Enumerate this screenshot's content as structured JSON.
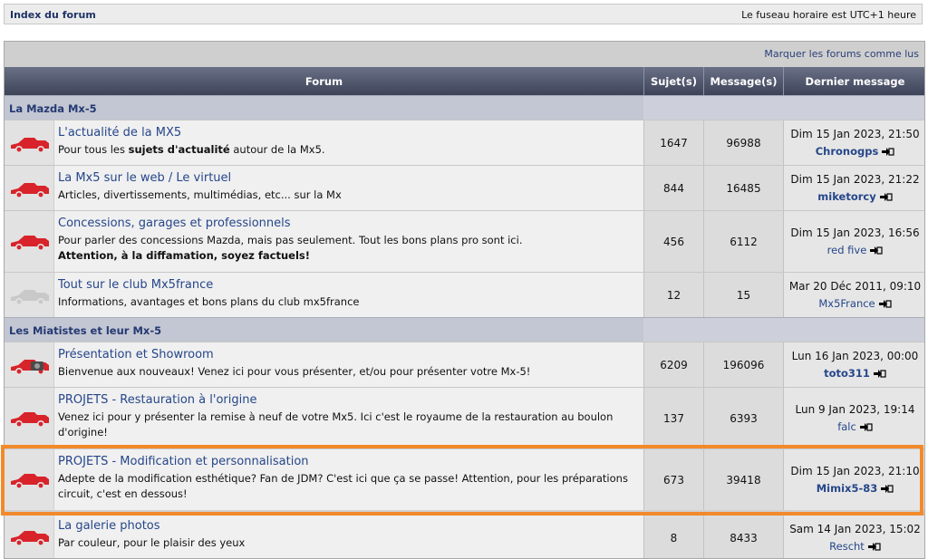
{
  "topbar": {
    "index_link": "Index du forum",
    "timezone": "Le fuseau horaire est UTC+1 heure"
  },
  "mark_read": "Marquer les forums comme lus",
  "columns": {
    "forum": "Forum",
    "topics": "Sujet(s)",
    "posts": "Message(s)",
    "last": "Dernier message"
  },
  "categories": [
    {
      "name": "La Mazda Mx-5"
    },
    {
      "name": "Les Miatistes et leur Mx-5"
    }
  ],
  "forums": [
    {
      "title": "L'actualité de la MX5",
      "desc_pre": "Pour tous les ",
      "desc_bold": "sujets d'actualité",
      "desc_post": " autour de la Mx5.",
      "topics": "1647",
      "posts": "96988",
      "last_date": "Dim 15 Jan 2023, 21:50",
      "last_author": "Chronogps",
      "icon": "red-car-icon"
    },
    {
      "title": "La Mx5 sur le web / Le virtuel",
      "desc": "Articles, divertissements, multimédias, etc... sur la Mx",
      "topics": "844",
      "posts": "16485",
      "last_date": "Dim 15 Jan 2023, 21:22",
      "last_author": "miketorcy",
      "icon": "red-car-icon"
    },
    {
      "title": "Concessions, garages et professionnels",
      "desc": "Pour parler des concessions Mazda, mais pas seulement. Tout les bons plans pro sont ici.",
      "desc2": "Attention, à la diffamation, soyez factuels!",
      "topics": "456",
      "posts": "6112",
      "last_date": "Dim 15 Jan 2023, 16:56",
      "last_author": "red five",
      "icon": "red-car-icon"
    },
    {
      "title": "Tout sur le club Mx5france",
      "desc": "Informations, avantages et bons plans du club mx5france",
      "topics": "12",
      "posts": "15",
      "last_date": "Mar 20 Déc 2011, 09:10",
      "last_author": "Mx5France",
      "icon": "grey-car-icon"
    },
    {
      "title": "Présentation et Showroom",
      "desc": "Bienvenue aux nouveaux! Venez ici pour vous présenter, et/ou pour présenter votre Mx-5!",
      "topics": "6209",
      "posts": "196096",
      "last_date": "Lun 16 Jan 2023, 00:00",
      "last_author": "toto311",
      "icon": "red-car-camera-icon"
    },
    {
      "title": "PROJETS - Restauration à l'origine",
      "desc": "Venez ici pour y présenter la remise à neuf de votre Mx5. Ici c'est le royaume de la restauration au boulon",
      "desc2": "d'origine!",
      "topics": "137",
      "posts": "6393",
      "last_date": "Lun 9 Jan 2023, 19:14",
      "last_author": "falc",
      "icon": "red-car-icon"
    },
    {
      "title": "PROJETS - Modification et personnalisation",
      "desc": "Adepte de la modification esthétique? Fan de JDM? C'est ici que ça se passe! Attention, pour les préparations",
      "desc2": "circuit, c'est en dessous!",
      "topics": "673",
      "posts": "39418",
      "last_date": "Dim 15 Jan 2023, 21:10",
      "last_author": "Mimix5-83",
      "icon": "red-car-icon"
    },
    {
      "title": "La galerie photos",
      "desc": "Par couleur, pour le plaisir des yeux",
      "topics": "8",
      "posts": "8433",
      "last_date": "Sam 14 Jan 2023, 15:02",
      "last_author": "Rescht",
      "icon": "red-car-icon"
    }
  ],
  "colors": {
    "link": "#25468a",
    "highlight": "#f28a2b",
    "car_red": "#d8232a"
  }
}
